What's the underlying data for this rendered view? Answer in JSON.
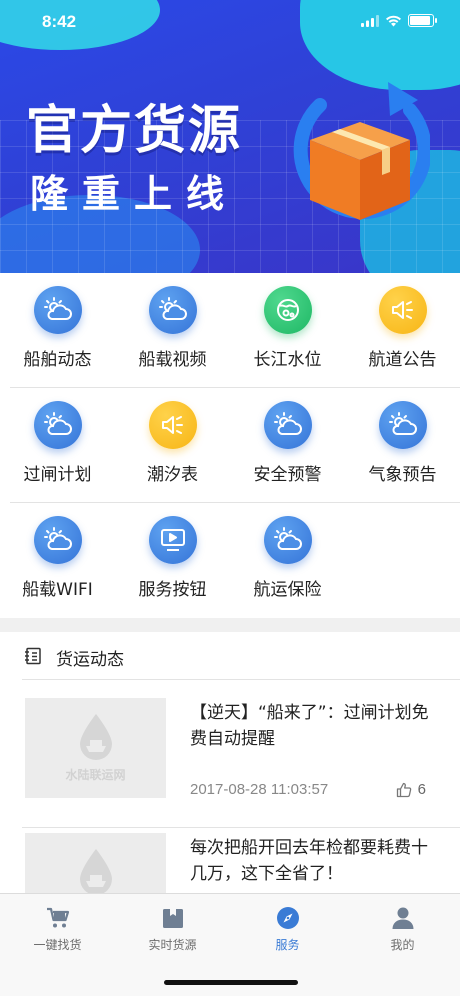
{
  "status_bar": {
    "time": "8:42"
  },
  "banner": {
    "title": "官方货源",
    "subtitle": "隆重上线"
  },
  "services": [
    {
      "label": "船舶动态",
      "icon": "cloud-sun-icon",
      "color": "blue"
    },
    {
      "label": "船载视频",
      "icon": "cloud-sun-icon",
      "color": "blue"
    },
    {
      "label": "长江水位",
      "icon": "water-level-icon",
      "color": "green"
    },
    {
      "label": "航道公告",
      "icon": "speaker-icon",
      "color": "yellow"
    },
    {
      "label": "过闸计划",
      "icon": "cloud-sun-icon",
      "color": "blue"
    },
    {
      "label": "潮汐表",
      "icon": "speaker-icon",
      "color": "yellow"
    },
    {
      "label": "安全预警",
      "icon": "cloud-sun-icon",
      "color": "blue"
    },
    {
      "label": "气象预告",
      "icon": "cloud-sun-icon",
      "color": "blue"
    },
    {
      "label": "船载WIFI",
      "icon": "cloud-sun-icon",
      "color": "blue"
    },
    {
      "label": "服务按钮",
      "icon": "monitor-play-icon",
      "color": "blue"
    },
    {
      "label": "航运保险",
      "icon": "cloud-sun-icon",
      "color": "blue"
    }
  ],
  "news": {
    "header": "货运动态",
    "thumb_watermark": "水陆联运网",
    "items": [
      {
        "title": "【逆天】“船来了”：过闸计划免费自动提醒",
        "date": "2017-08-28 11:03:57",
        "likes": "6"
      },
      {
        "title": "每次把船开回去年检都要耗费十几万，这下全省了！"
      }
    ]
  },
  "tabbar": {
    "items": [
      {
        "label": "一键找货",
        "icon": "cart-icon"
      },
      {
        "label": "实时货源",
        "icon": "box-icon"
      },
      {
        "label": "服务",
        "icon": "compass-icon",
        "active": true
      },
      {
        "label": "我的",
        "icon": "user-icon"
      }
    ]
  },
  "colors": {
    "accent": "#3a7bd5",
    "banner": "#2f41d6",
    "green": "#1fb865",
    "yellow": "#f7b515"
  }
}
